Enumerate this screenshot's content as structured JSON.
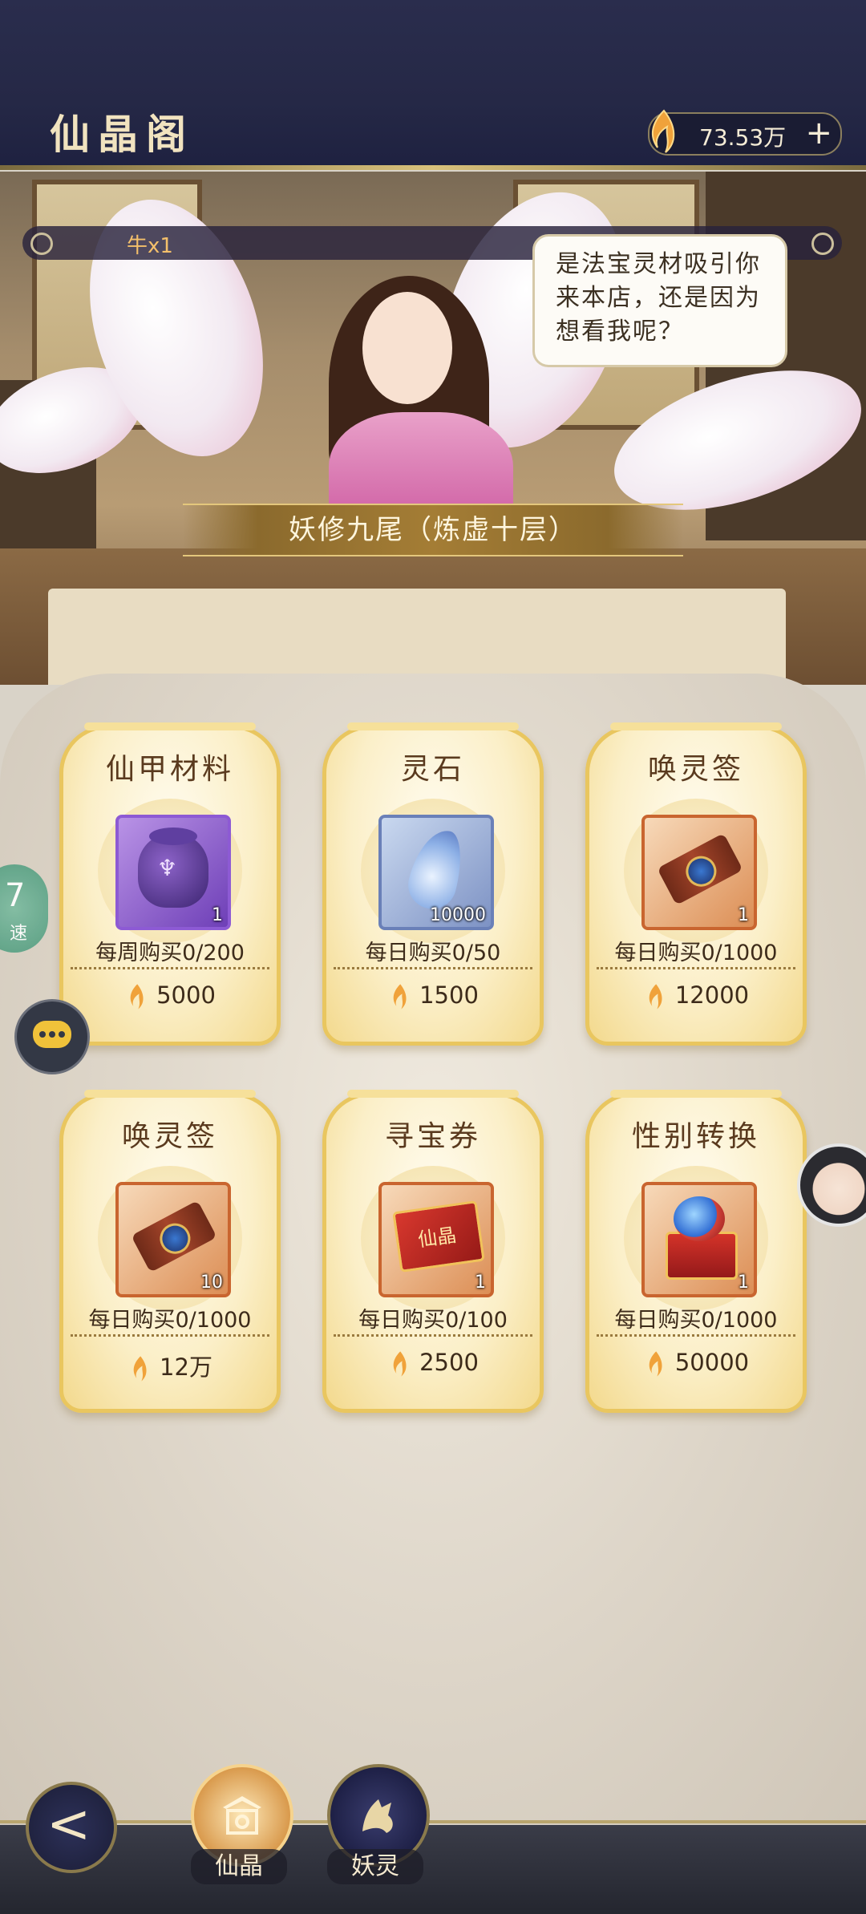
{
  "header": {
    "title": "仙晶阁",
    "currency": {
      "amount": "73.53万",
      "add_label": "+"
    }
  },
  "scene": {
    "marquee_text": "牛x1",
    "dialogue": [
      "是法宝灵材吸引你",
      "来本店，还是因为",
      "想看我呢？"
    ],
    "npc_name": "妖修九尾（炼虚十层）"
  },
  "shop": {
    "items": [
      {
        "name": "仙甲材料",
        "qty": "1",
        "limit": "每周购买0/200",
        "price": "5000",
        "rarity": "purple",
        "icon": "bag-icon"
      },
      {
        "name": "灵石",
        "qty": "10000",
        "limit": "每日购买0/50",
        "price": "1500",
        "rarity": "blue",
        "icon": "spirit-stone-icon"
      },
      {
        "name": "唤灵签",
        "qty": "1",
        "limit": "每日购买0/1000",
        "price": "12000",
        "rarity": "orange",
        "icon": "scroll-icon"
      },
      {
        "name": "唤灵签",
        "qty": "10",
        "limit": "每日购买0/1000",
        "price": "12万",
        "rarity": "orange",
        "icon": "scroll-icon"
      },
      {
        "name": "寻宝券",
        "qty": "1",
        "limit": "每日购买0/100",
        "price": "2500",
        "rarity": "orange",
        "icon": "ticket-icon"
      },
      {
        "name": "性别转换",
        "qty": "1",
        "limit": "每日购买0/1000",
        "price": "50000",
        "rarity": "orange",
        "icon": "orb-box-icon"
      }
    ],
    "ticket_text": "仙晶"
  },
  "side": {
    "speed_number": "7",
    "speed_label": "速"
  },
  "nav": {
    "back_label": "<",
    "tabs": [
      {
        "label": "仙晶"
      },
      {
        "label": "妖灵"
      }
    ]
  },
  "colors": {
    "header_bg": "#2a2d4d",
    "gold": "#e9c65f",
    "currency_gem": "#f0a23a"
  }
}
